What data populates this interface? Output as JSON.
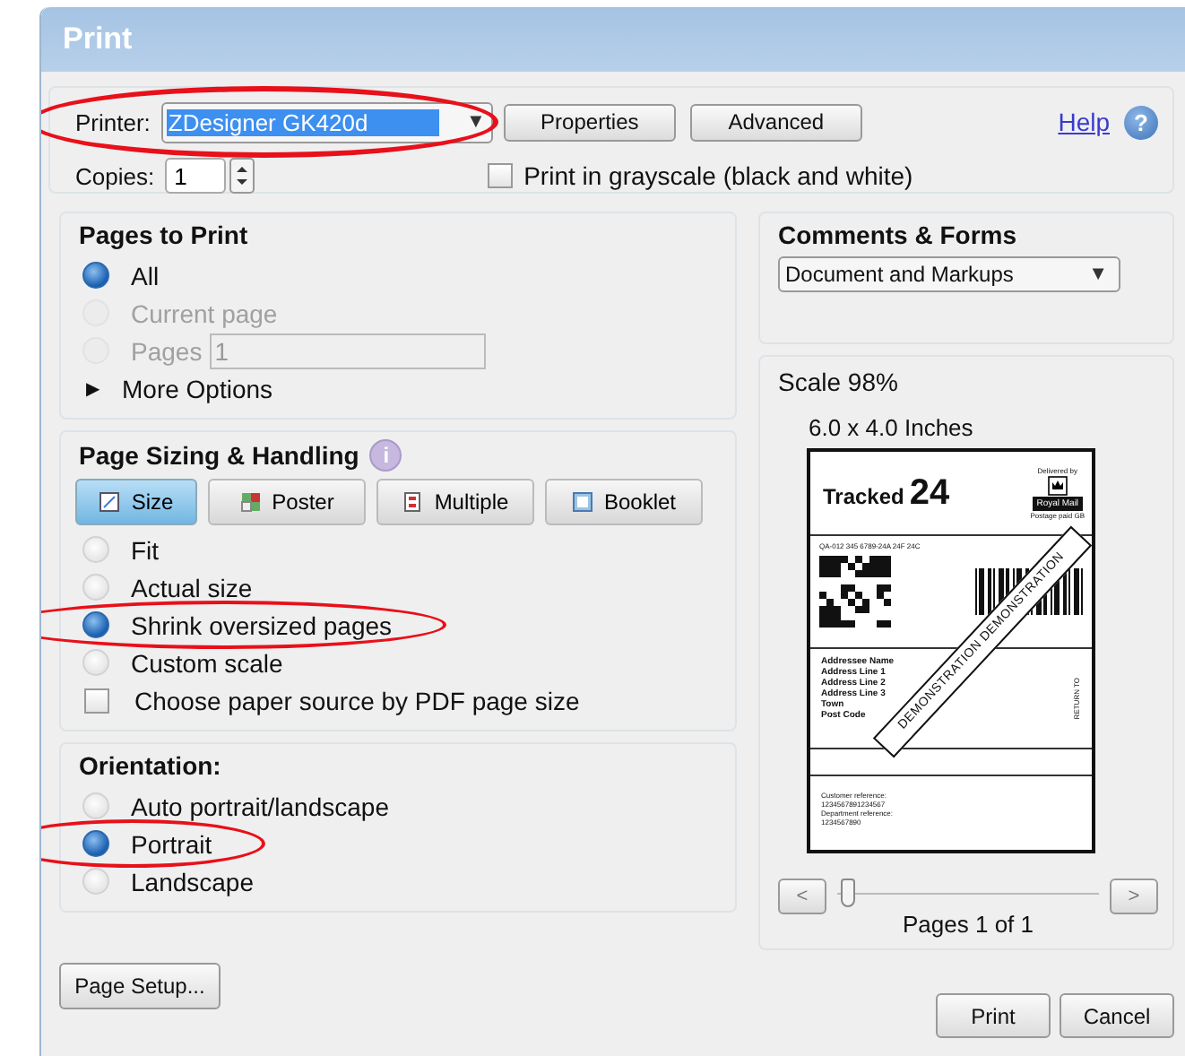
{
  "window": {
    "title": "Print"
  },
  "printer": {
    "label": "Printer:",
    "value": "ZDesigner GK420d",
    "arrow": "▼",
    "circled": true
  },
  "top_buttons": [
    {
      "label": "Properties"
    },
    {
      "label": "Advanced"
    }
  ],
  "help": {
    "label": "Help",
    "icon": "?"
  },
  "copies": {
    "label": "Copies:",
    "value": "1"
  },
  "grayscale": {
    "label": "Print in grayscale (black and white)",
    "checked": false
  },
  "pages_to_print": {
    "title": "Pages to Print",
    "options": [
      {
        "label": "All",
        "selected": true,
        "disabled": false
      },
      {
        "label": "Current page",
        "selected": false,
        "disabled": true
      },
      {
        "label": "Pages",
        "selected": false,
        "disabled": true,
        "value": "1"
      }
    ],
    "more_options": {
      "arrow": "▶",
      "label": "More Options",
      "expanded": false
    }
  },
  "page_sizing": {
    "title": "Page Sizing & Handling",
    "info_icon": "i",
    "tabs": [
      {
        "label": "Size",
        "selected": true
      },
      {
        "label": "Poster",
        "selected": false
      },
      {
        "label": "Multiple",
        "selected": false
      },
      {
        "label": "Booklet",
        "selected": false
      }
    ],
    "options": [
      {
        "label": "Fit",
        "selected": false
      },
      {
        "label": "Actual size",
        "selected": false
      },
      {
        "label": "Shrink oversized pages",
        "selected": true,
        "circled": true
      },
      {
        "label": "Custom scale",
        "selected": false
      }
    ],
    "paper_source": {
      "label": "Choose paper source by PDF page size",
      "checked": false
    }
  },
  "orientation": {
    "title": "Orientation:",
    "options": [
      {
        "label": "Auto portrait/landscape",
        "selected": false
      },
      {
        "label": "Portrait",
        "selected": true,
        "circled": true
      },
      {
        "label": "Landscape",
        "selected": false
      }
    ]
  },
  "comments_forms": {
    "title": "Comments & Forms",
    "value": "Document and Markups",
    "arrow": "▼"
  },
  "preview": {
    "scale": "Scale 98%",
    "size": "6.0 x 4.0 Inches",
    "label": {
      "service": "Tracked",
      "service_number": "24",
      "delivered_by": "Delivered by",
      "carrier": "Royal Mail",
      "postage": "Postage paid GB",
      "tracking": "QA-012 345 6789-24A 24F 24C",
      "address": [
        "Addressee Name",
        "Address Line 1",
        "Address Line 2",
        "Address Line 3",
        "Town",
        "Post Code"
      ],
      "return_to": "RETURN TO",
      "references": [
        "Customer reference:",
        "1234567891234567",
        "Department reference:",
        "1234567890"
      ],
      "banner": "DEMONSTRATION DEMONSTRATION"
    },
    "prev": "<",
    "next": ">",
    "slider": {
      "level": 0
    },
    "pages": "Pages 1 of 1"
  },
  "footer": {
    "page_setup": "Page Setup...",
    "buttons": [
      {
        "label": "Print"
      },
      {
        "label": "Cancel"
      }
    ]
  }
}
